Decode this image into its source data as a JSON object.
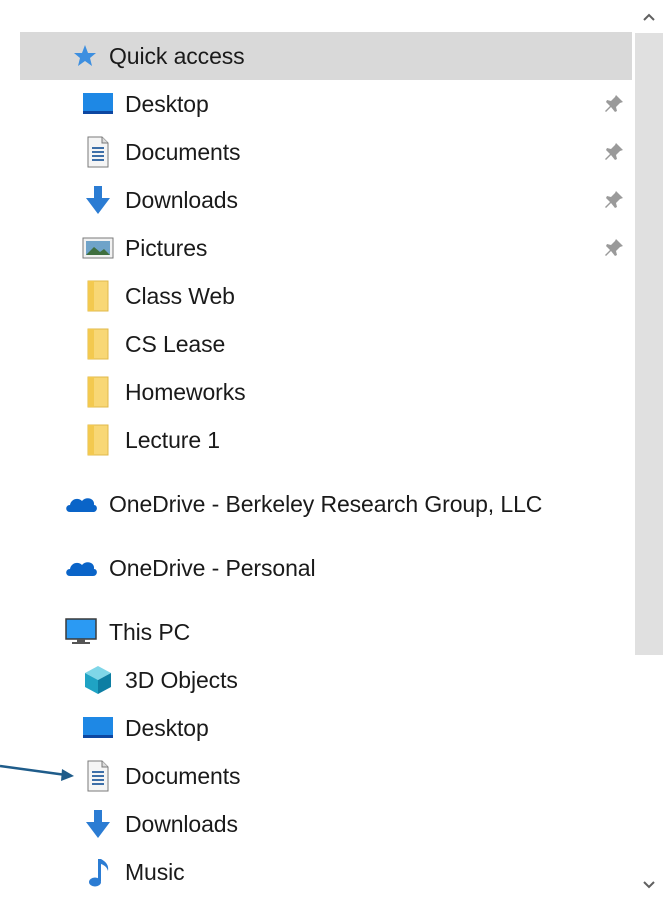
{
  "nav": {
    "quick_access": {
      "label": "Quick access"
    },
    "quick_items": [
      {
        "label": "Desktop",
        "icon": "desktop-icon",
        "pinned": true
      },
      {
        "label": "Documents",
        "icon": "documents-icon",
        "pinned": true
      },
      {
        "label": "Downloads",
        "icon": "downloads-icon",
        "pinned": true
      },
      {
        "label": "Pictures",
        "icon": "pictures-icon",
        "pinned": true
      },
      {
        "label": "Class Web",
        "icon": "folder-icon",
        "pinned": false
      },
      {
        "label": "CS Lease",
        "icon": "folder-icon",
        "pinned": false
      },
      {
        "label": "Homeworks",
        "icon": "folder-icon",
        "pinned": false
      },
      {
        "label": "Lecture 1",
        "icon": "folder-icon",
        "pinned": false
      }
    ],
    "onedrive_business": {
      "label": "OneDrive - Berkeley Research Group, LLC"
    },
    "onedrive_personal": {
      "label": "OneDrive - Personal"
    },
    "this_pc": {
      "label": "This PC",
      "items": [
        {
          "label": "3D Objects",
          "icon": "3d-objects-icon"
        },
        {
          "label": "Desktop",
          "icon": "desktop-icon"
        },
        {
          "label": "Documents",
          "icon": "documents-icon"
        },
        {
          "label": "Downloads",
          "icon": "downloads-icon"
        },
        {
          "label": "Music",
          "icon": "music-icon"
        }
      ]
    }
  },
  "colors": {
    "selected_bg": "#d9d9d9",
    "folder": "#f8d775",
    "accent_blue": "#2b7cd3",
    "annotation_arrow": "#1f5c8a"
  }
}
